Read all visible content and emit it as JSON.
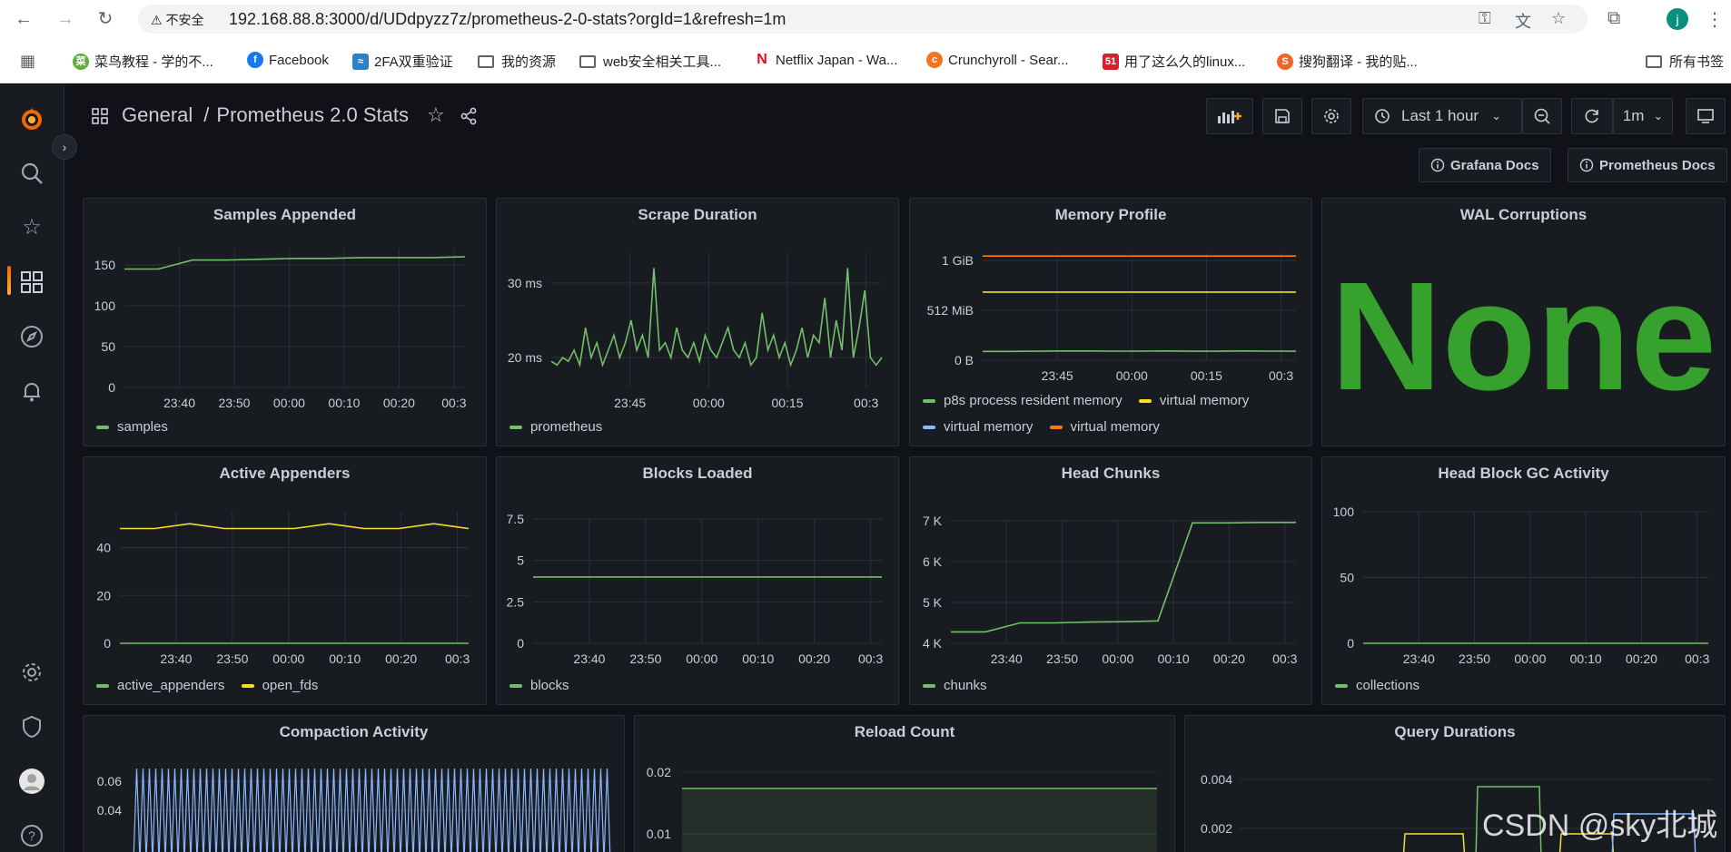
{
  "browser": {
    "insecure_label": "不安全",
    "url": "192.168.88.8:3000/d/UDdpyzz7z/prometheus-2-0-stats?orgId=1&refresh=1m",
    "profile_initial": "j",
    "bookmarks": [
      {
        "label": "菜鸟教程 - 学的不..."
      },
      {
        "label": "Facebook"
      },
      {
        "label": "2FA双重验证"
      },
      {
        "label": "我的资源"
      },
      {
        "label": "web安全相关工具..."
      },
      {
        "label": "Netflix Japan - Wa..."
      },
      {
        "label": "Crunchyroll - Sear..."
      },
      {
        "label": "用了这么久的linux..."
      },
      {
        "label": "搜狗翻译 - 我的贴..."
      },
      {
        "label": "所有书签"
      }
    ]
  },
  "dashboard": {
    "folder": "General",
    "separator": "/",
    "title": "Prometheus 2.0 Stats",
    "time_range": "Last 1 hour",
    "refresh": "1m",
    "links": [
      "Grafana Docs",
      "Prometheus Docs"
    ]
  },
  "colors": {
    "green": "#73bf69",
    "yellow": "#fade2a",
    "blue": "#8ab8ff",
    "orange": "#ff780a",
    "stat_green": "#37a12d",
    "bg": "#111217",
    "panel_bg": "#181b1f"
  },
  "panels": {
    "samples_appended": {
      "title": "Samples Appended",
      "legend": [
        "samples"
      ]
    },
    "scrape_duration": {
      "title": "Scrape Duration",
      "legend": [
        "prometheus"
      ]
    },
    "memory_profile": {
      "title": "Memory Profile",
      "legend": [
        "p8s process resident memory",
        "virtual memory",
        "virtual memory",
        "virtual memory"
      ]
    },
    "wal_corruptions": {
      "title": "WAL Corruptions",
      "value": "None"
    },
    "active_appenders": {
      "title": "Active Appenders",
      "legend": [
        "active_appenders",
        "open_fds"
      ]
    },
    "blocks_loaded": {
      "title": "Blocks Loaded",
      "legend": [
        "blocks"
      ]
    },
    "head_chunks": {
      "title": "Head Chunks",
      "legend": [
        "chunks"
      ]
    },
    "head_block_gc": {
      "title": "Head Block GC Activity",
      "legend": [
        "collections"
      ]
    },
    "compaction_activity": {
      "title": "Compaction Activity"
    },
    "reload_count": {
      "title": "Reload Count"
    },
    "query_durations": {
      "title": "Query Durations"
    }
  },
  "chart_data": [
    {
      "panel": "Samples Appended",
      "type": "line",
      "x": [
        "23:40",
        "23:50",
        "00:00",
        "00:10",
        "00:20",
        "00:3"
      ],
      "y_ticks": [
        "0",
        "50",
        "100",
        "150"
      ],
      "ylim": [
        0,
        170
      ],
      "series": [
        {
          "name": "samples",
          "color": "#73bf69",
          "values": [
            145,
            145,
            156,
            156,
            157,
            158,
            158,
            159,
            159,
            159,
            160
          ]
        }
      ]
    },
    {
      "panel": "Scrape Duration",
      "type": "line",
      "x": [
        "23:45",
        "00:00",
        "00:15",
        "00:3"
      ],
      "y_ticks": [
        "20 ms",
        "30 ms"
      ],
      "ylim": [
        16,
        34
      ],
      "series": [
        {
          "name": "prometheus",
          "color": "#73bf69",
          "values": [
            19.5,
            19,
            20,
            19.5,
            21,
            19,
            24,
            20,
            22,
            19,
            21,
            23,
            20,
            22,
            25,
            21,
            23,
            20,
            32,
            21,
            22,
            20,
            24,
            21,
            20,
            22,
            19.5,
            23,
            21,
            20,
            22,
            24,
            21,
            20,
            22,
            19,
            20,
            26,
            21,
            23,
            20,
            22,
            19,
            21,
            24,
            20,
            23,
            22,
            28,
            20,
            25,
            21,
            32,
            20,
            24,
            29,
            20,
            19,
            20
          ]
        }
      ]
    },
    {
      "panel": "Memory Profile",
      "type": "line",
      "x": [
        "23:45",
        "00:00",
        "00:15",
        "00:3"
      ],
      "y_ticks": [
        "0 B",
        "512 MiB",
        "1 GiB"
      ],
      "ylim": [
        0,
        1100
      ],
      "series": [
        {
          "name": "p8s process resident memory",
          "color": "#73bf69",
          "values": [
            90,
            90,
            92,
            95,
            95,
            93,
            93,
            95,
            92,
            92,
            95,
            93,
            92
          ]
        },
        {
          "name": "virtual memory",
          "color": "#fade2a",
          "values": [
            700,
            700,
            700,
            700,
            700,
            700,
            700,
            700,
            700,
            700,
            700,
            700,
            700
          ]
        },
        {
          "name": "virtual memory",
          "color": "#8ab8ff",
          "values": []
        },
        {
          "name": "virtual memory",
          "color": "#ff780a",
          "values": [
            1070,
            1070,
            1070,
            1070,
            1070,
            1070,
            1070,
            1070,
            1070,
            1070,
            1070,
            1070,
            1070
          ]
        }
      ]
    },
    {
      "panel": "Active Appenders",
      "type": "line",
      "x": [
        "23:40",
        "23:50",
        "00:00",
        "00:10",
        "00:20",
        "00:3"
      ],
      "y_ticks": [
        "0",
        "20",
        "40"
      ],
      "ylim": [
        0,
        55
      ],
      "series": [
        {
          "name": "active_appenders",
          "color": "#73bf69",
          "values": [
            0,
            0,
            0,
            0,
            0,
            0,
            0,
            0,
            0,
            0,
            0
          ]
        },
        {
          "name": "open_fds",
          "color": "#fade2a",
          "values": [
            48,
            48,
            50,
            48,
            48,
            48,
            50,
            48,
            48,
            50,
            48
          ]
        }
      ]
    },
    {
      "panel": "Blocks Loaded",
      "type": "line",
      "x": [
        "23:40",
        "23:50",
        "00:00",
        "00:10",
        "00:20",
        "00:3"
      ],
      "y_ticks": [
        "0",
        "2.5",
        "5",
        "7.5"
      ],
      "ylim": [
        0,
        7.5
      ],
      "series": [
        {
          "name": "blocks",
          "color": "#73bf69",
          "values": [
            4,
            4,
            4,
            4,
            4,
            4,
            4,
            4,
            4,
            4,
            4
          ]
        }
      ]
    },
    {
      "panel": "Head Chunks",
      "type": "line",
      "x": [
        "23:40",
        "23:50",
        "00:00",
        "00:10",
        "00:20",
        "00:3"
      ],
      "y_ticks": [
        "4 K",
        "5 K",
        "6 K",
        "7 K"
      ],
      "ylim": [
        4000,
        7000
      ],
      "series": [
        {
          "name": "chunks",
          "color": "#73bf69",
          "values": [
            4280,
            4280,
            4500,
            4500,
            4520,
            4530,
            4550,
            6950,
            6950,
            6960,
            6960
          ]
        }
      ]
    },
    {
      "panel": "Head Block GC Activity",
      "type": "line",
      "x": [
        "23:40",
        "23:50",
        "00:00",
        "00:10",
        "00:20",
        "00:3"
      ],
      "y_ticks": [
        "0",
        "50",
        "100"
      ],
      "ylim": [
        0,
        100
      ],
      "series": [
        {
          "name": "collections",
          "color": "#73bf69",
          "values": [
            0,
            0,
            0,
            0,
            0,
            0,
            0,
            0,
            0,
            0,
            0
          ]
        }
      ]
    },
    {
      "panel": "Compaction Activity",
      "type": "line",
      "y_ticks": [
        "0.04",
        "0.06"
      ],
      "series": [
        {
          "color": "#8ab8ff",
          "pattern": "oscillating"
        }
      ]
    },
    {
      "panel": "Reload Count",
      "type": "area",
      "y_ticks": [
        "0.01",
        "0.02"
      ],
      "series": [
        {
          "color": "#73bf69",
          "values": [
            0.017,
            0.017
          ]
        }
      ]
    },
    {
      "panel": "Query Durations",
      "type": "line",
      "y_ticks": [
        "0.002",
        "0.004"
      ],
      "series": [
        {
          "color": "#73bf69"
        },
        {
          "color": "#fade2a"
        },
        {
          "color": "#8ab8ff"
        }
      ]
    }
  ],
  "watermark": "CSDN @sky北城"
}
